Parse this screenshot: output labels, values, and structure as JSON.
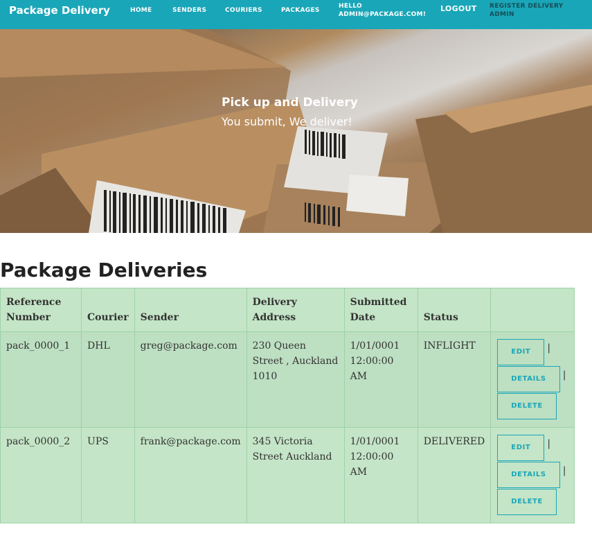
{
  "navbar": {
    "brand": "Package Delivery",
    "links": {
      "home": "HOME",
      "senders": "SENDERS",
      "couriers": "COURIERS",
      "packages": "PACKAGES",
      "hello": "HELLO ADMIN@PACKAGE.COM!",
      "logout": "LOGOUT",
      "register": "REGISTER DELIVERY ADMIN"
    }
  },
  "hero": {
    "title": "Pick up and Delivery",
    "subtitle": "You submit, We deliver!"
  },
  "main": {
    "title": "Package Deliveries",
    "table": {
      "headers": [
        "Reference Number",
        "Courier",
        "Sender",
        "Delivery Address",
        "Submitted Date",
        "Status",
        ""
      ],
      "rows": [
        {
          "reference": "pack_0000_1",
          "courier": "DHL",
          "sender": "greg@package.com",
          "address": "230 Queen Street , Auckland 1010",
          "date": "1/01/0001 12:00:00 AM",
          "status": "INFLIGHT"
        },
        {
          "reference": "pack_0000_2",
          "courier": "UPS",
          "sender": "frank@package.com",
          "address": "345 Victoria Street Auckland",
          "date": "1/01/0001 12:00:00 AM",
          "status": "DELIVERED"
        }
      ],
      "actions": {
        "edit": "EDIT",
        "details": "DETAILS",
        "delete": "DELETE",
        "separator": "|"
      }
    }
  }
}
